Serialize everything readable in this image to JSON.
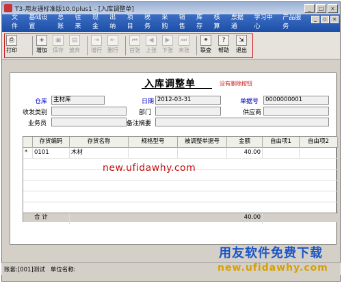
{
  "window": {
    "title": "T3-用友通标准版10.0plus1 - [入库调整单]"
  },
  "menu": [
    "文件",
    "基础设置",
    "总账",
    "往来",
    "现金",
    "出纳",
    "项目",
    "税务",
    "采购",
    "销售",
    "库存",
    "核算",
    "票据通",
    "学习中心",
    "产品服务"
  ],
  "toolbar": {
    "print": "打印",
    "add": "增加",
    "save": "保存",
    "discard": "放弃",
    "addrow": "增行",
    "delrow": "删行",
    "first": "首张",
    "prev": "上张",
    "next": "下张",
    "last": "末张",
    "query": "联查",
    "help": "帮助",
    "exit": "退出"
  },
  "form": {
    "title": "入库调整单",
    "note": "没有删除按钮",
    "warehouse_label": "仓库",
    "warehouse": "主材库",
    "date_label": "日期",
    "date": "2012-03-31",
    "docno_label": "单据号",
    "docno": "0000000001",
    "recv_label": "收发类别",
    "dept_label": "部门",
    "supplier_label": "供应商",
    "clerk_label": "业务员",
    "remark_label": "备注摘要"
  },
  "grid": {
    "columns": [
      "存货编码",
      "存货名称",
      "规格型号",
      "被调整单据号",
      "金额",
      "自由项1",
      "自由项2"
    ],
    "rows": [
      {
        "marker": "*",
        "code": "0101",
        "name": "木材",
        "spec": "",
        "ref": "",
        "amount": "40.00"
      }
    ],
    "total_label": "合    计",
    "total_amount": "40.00"
  },
  "watermark": "new.ufidawhy.com",
  "status": {
    "account": "账套:[001]测试",
    "unit": "单位名称:"
  },
  "brand": {
    "line1": "用友软件免费下载",
    "line2": "new.ufidawhy.com"
  }
}
